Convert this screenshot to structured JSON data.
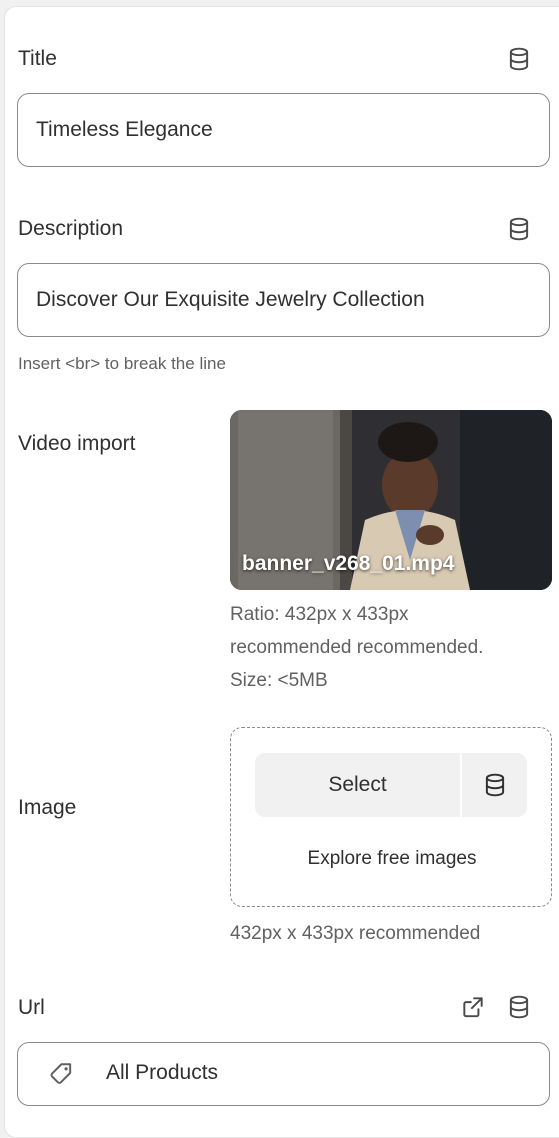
{
  "title_field": {
    "label": "Title",
    "value": "Timeless Elegance",
    "icon": "database-icon"
  },
  "description_field": {
    "label": "Description",
    "value": "Discover Our Exquisite Jewelry Collection",
    "hint": "Insert <br> to break the line",
    "icon": "database-icon"
  },
  "video_field": {
    "label": "Video import",
    "filename": "banner_v268_01.mp4",
    "info_line1": "Ratio: 432px x 433px",
    "info_line2": "recommended recommended.",
    "info_line3": "Size: <5MB"
  },
  "image_field": {
    "label": "Image",
    "select_label": "Select",
    "explore_label": "Explore free images",
    "hint": "432px x 433px recommended"
  },
  "url_field": {
    "label": "Url",
    "value": "All Products",
    "icons": [
      "external-link-icon",
      "database-icon",
      "tag-icon"
    ]
  },
  "colors": {
    "panel_bg": "#ffffff",
    "page_bg": "#f1f1f1",
    "text": "#303030",
    "muted_text": "#616161",
    "border": "#8a8a8a"
  }
}
